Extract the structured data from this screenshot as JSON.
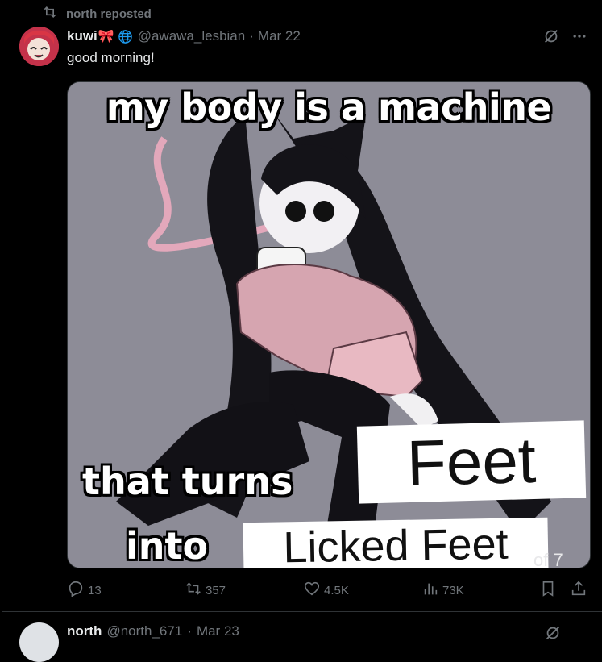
{
  "repost": {
    "label": "north reposted"
  },
  "tweet": {
    "display_name": "kuwi",
    "name_emoji": "🎀",
    "handle": "@awawa_lesbian",
    "separator": "·",
    "date": "Mar 22",
    "text": "good morning!"
  },
  "media": {
    "line_top": "my body is a machine",
    "line_that_turns": "that turns",
    "line_into": "into",
    "label_feet": "Feet",
    "label_licked": "Licked Feet",
    "watermark": "of 7"
  },
  "actions": {
    "replies": "13",
    "reposts": "357",
    "likes": "4.5K",
    "views": "73K"
  },
  "next_tweet": {
    "display_name": "north",
    "handle": "@north_671",
    "separator": "·",
    "date": "Mar 23"
  },
  "colors": {
    "background": "#000000",
    "text_primary": "#e7e9ea",
    "text_secondary": "#71767b",
    "divider": "#2f3336",
    "bow": "#f4212e"
  },
  "icons": {
    "repost": "repost-icon",
    "globe": "globe-icon",
    "grok": "grok-icon",
    "more": "more-icon",
    "reply": "reply-icon",
    "like": "heart-icon",
    "views": "views-icon",
    "bookmark": "bookmark-icon",
    "share": "share-icon"
  }
}
